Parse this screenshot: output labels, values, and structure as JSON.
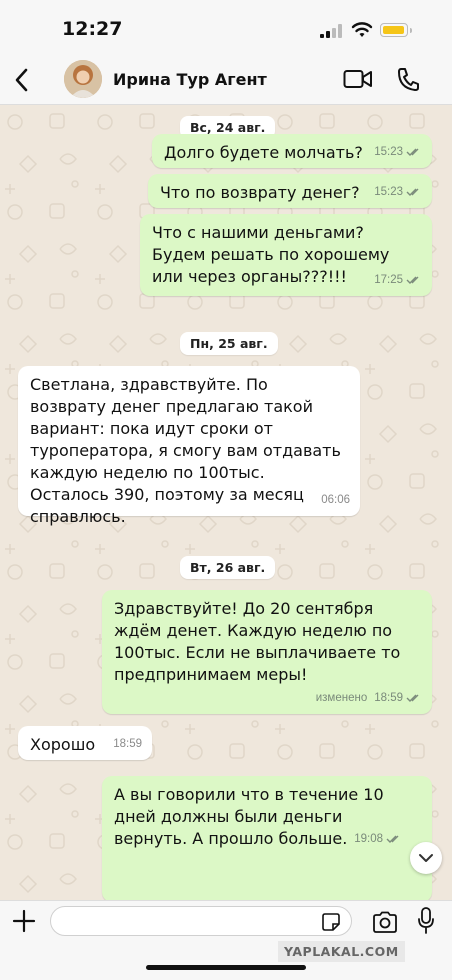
{
  "status_bar": {
    "time": "12:27"
  },
  "header": {
    "contact_name": "Ирина Тур Агент"
  },
  "colors": {
    "outgoing_bubble": "#dcf8c6",
    "incoming_bubble": "#ffffff",
    "read_ticks": "#53bdeb",
    "battery": "#f5c518"
  },
  "messages": {
    "d1": {
      "date": "Вс, 24 авг."
    },
    "m1": {
      "text": "Долго будете молчать?",
      "time": "15:23"
    },
    "m2": {
      "text": "Что по возврату денег?",
      "time": "15:23"
    },
    "m3": {
      "text": "Что с нашими деньгами? Будем решать по хорошему или через органы???!!!",
      "time": "17:25"
    },
    "d2": {
      "date": "Пн, 25 авг."
    },
    "m4": {
      "text": "Светлана, здравствуйте. По возврату денег предлагаю такой вариант: пока идут сроки от туроператора, я смогу вам отдавать каждую неделю по 100тыс. Осталось 390, поэтому за месяц справлюсь.",
      "time": "06:06"
    },
    "d3": {
      "date": "Вт, 26 авг."
    },
    "m5": {
      "text": "Здравствуйте! До 20 сентября ждём денет. Каждую неделю по 100тыс. Если не выплачиваете то предпринимаем меры!",
      "edited": "изменено",
      "time": "18:59"
    },
    "m6": {
      "text": "Хорошо",
      "time": "18:59"
    },
    "m7": {
      "text": "А вы говорили что в течение 10 дней должны были деньги вернуть. А прошло больше.",
      "time": "19:08"
    }
  },
  "composer": {
    "placeholder": ""
  },
  "watermark": "YAPLAKAL.COM",
  "icons": [
    "back-arrow-icon",
    "video-call-icon",
    "phone-icon",
    "plus-icon",
    "sticker-icon",
    "camera-icon",
    "microphone-icon",
    "chevron-down-icon",
    "double-check-icon"
  ]
}
